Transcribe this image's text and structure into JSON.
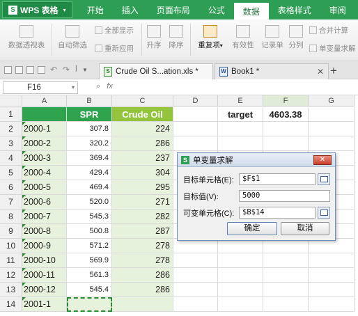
{
  "app": {
    "name": "WPS 表格",
    "logo_letter": "S"
  },
  "menu": [
    "开始",
    "插入",
    "页面布局",
    "公式",
    "数据",
    "表格样式",
    "审阅"
  ],
  "menu_active_index": 4,
  "ribbon": {
    "pivot": "数据透视表",
    "autofilter": "自动筛选",
    "show_all": "全部显示",
    "reapply": "重新应用",
    "sort_asc": "升序",
    "sort_desc": "降序",
    "duplicates": "重复项",
    "validity": "有效性",
    "record_form": "记录单",
    "split": "分列",
    "merge_calc": "合并计算",
    "goal_seek": "单变量求解"
  },
  "tabs": [
    {
      "label": "Crude Oil S...ation.xls *",
      "icon": "xls"
    },
    {
      "label": "Book1 *",
      "icon": "doc"
    }
  ],
  "namebox": "F16",
  "fx": "fx",
  "columns": [
    "A",
    "B",
    "C",
    "D",
    "E",
    "F",
    "G"
  ],
  "selected_column": "F",
  "headers": {
    "b": "SPR",
    "c": "Crude Oil"
  },
  "target": {
    "label": "target",
    "value": "4603.38"
  },
  "rows": [
    {
      "n": "1"
    },
    {
      "n": "2",
      "a": "2000-1",
      "b": "307.8",
      "c": "224"
    },
    {
      "n": "3",
      "a": "2000-2",
      "b": "320.2",
      "c": "286"
    },
    {
      "n": "4",
      "a": "2000-3",
      "b": "369.4",
      "c": "237"
    },
    {
      "n": "5",
      "a": "2000-4",
      "b": "429.4",
      "c": "304"
    },
    {
      "n": "6",
      "a": "2000-5",
      "b": "469.4",
      "c": "295"
    },
    {
      "n": "7",
      "a": "2000-6",
      "b": "520.0",
      "c": "271"
    },
    {
      "n": "8",
      "a": "2000-7",
      "b": "545.3",
      "c": "282"
    },
    {
      "n": "9",
      "a": "2000-8",
      "b": "500.8",
      "c": "287"
    },
    {
      "n": "10",
      "a": "2000-9",
      "b": "571.2",
      "c": "278"
    },
    {
      "n": "11",
      "a": "2000-10",
      "b": "569.9",
      "c": "278"
    },
    {
      "n": "12",
      "a": "2000-11",
      "b": "561.3",
      "c": "286"
    },
    {
      "n": "13",
      "a": "2000-12",
      "b": "545.4",
      "c": "286"
    },
    {
      "n": "14",
      "a": "2001-1",
      "b": "",
      "c": ""
    }
  ],
  "dialog": {
    "title": "单变量求解",
    "close": "✕",
    "target_cell_label": "目标单元格(E):",
    "target_cell_value": "$F$1",
    "target_value_label": "目标值(V):",
    "target_value_value": "5000",
    "variable_cell_label": "可变单元格(C):",
    "variable_cell_value": "$B$14",
    "ok": "确定",
    "cancel": "取消"
  },
  "colors": {
    "accent": "#2f9e55",
    "header_green": "#2fa34e",
    "header_lime": "#93c43c",
    "light_green": "#e6f2db"
  }
}
